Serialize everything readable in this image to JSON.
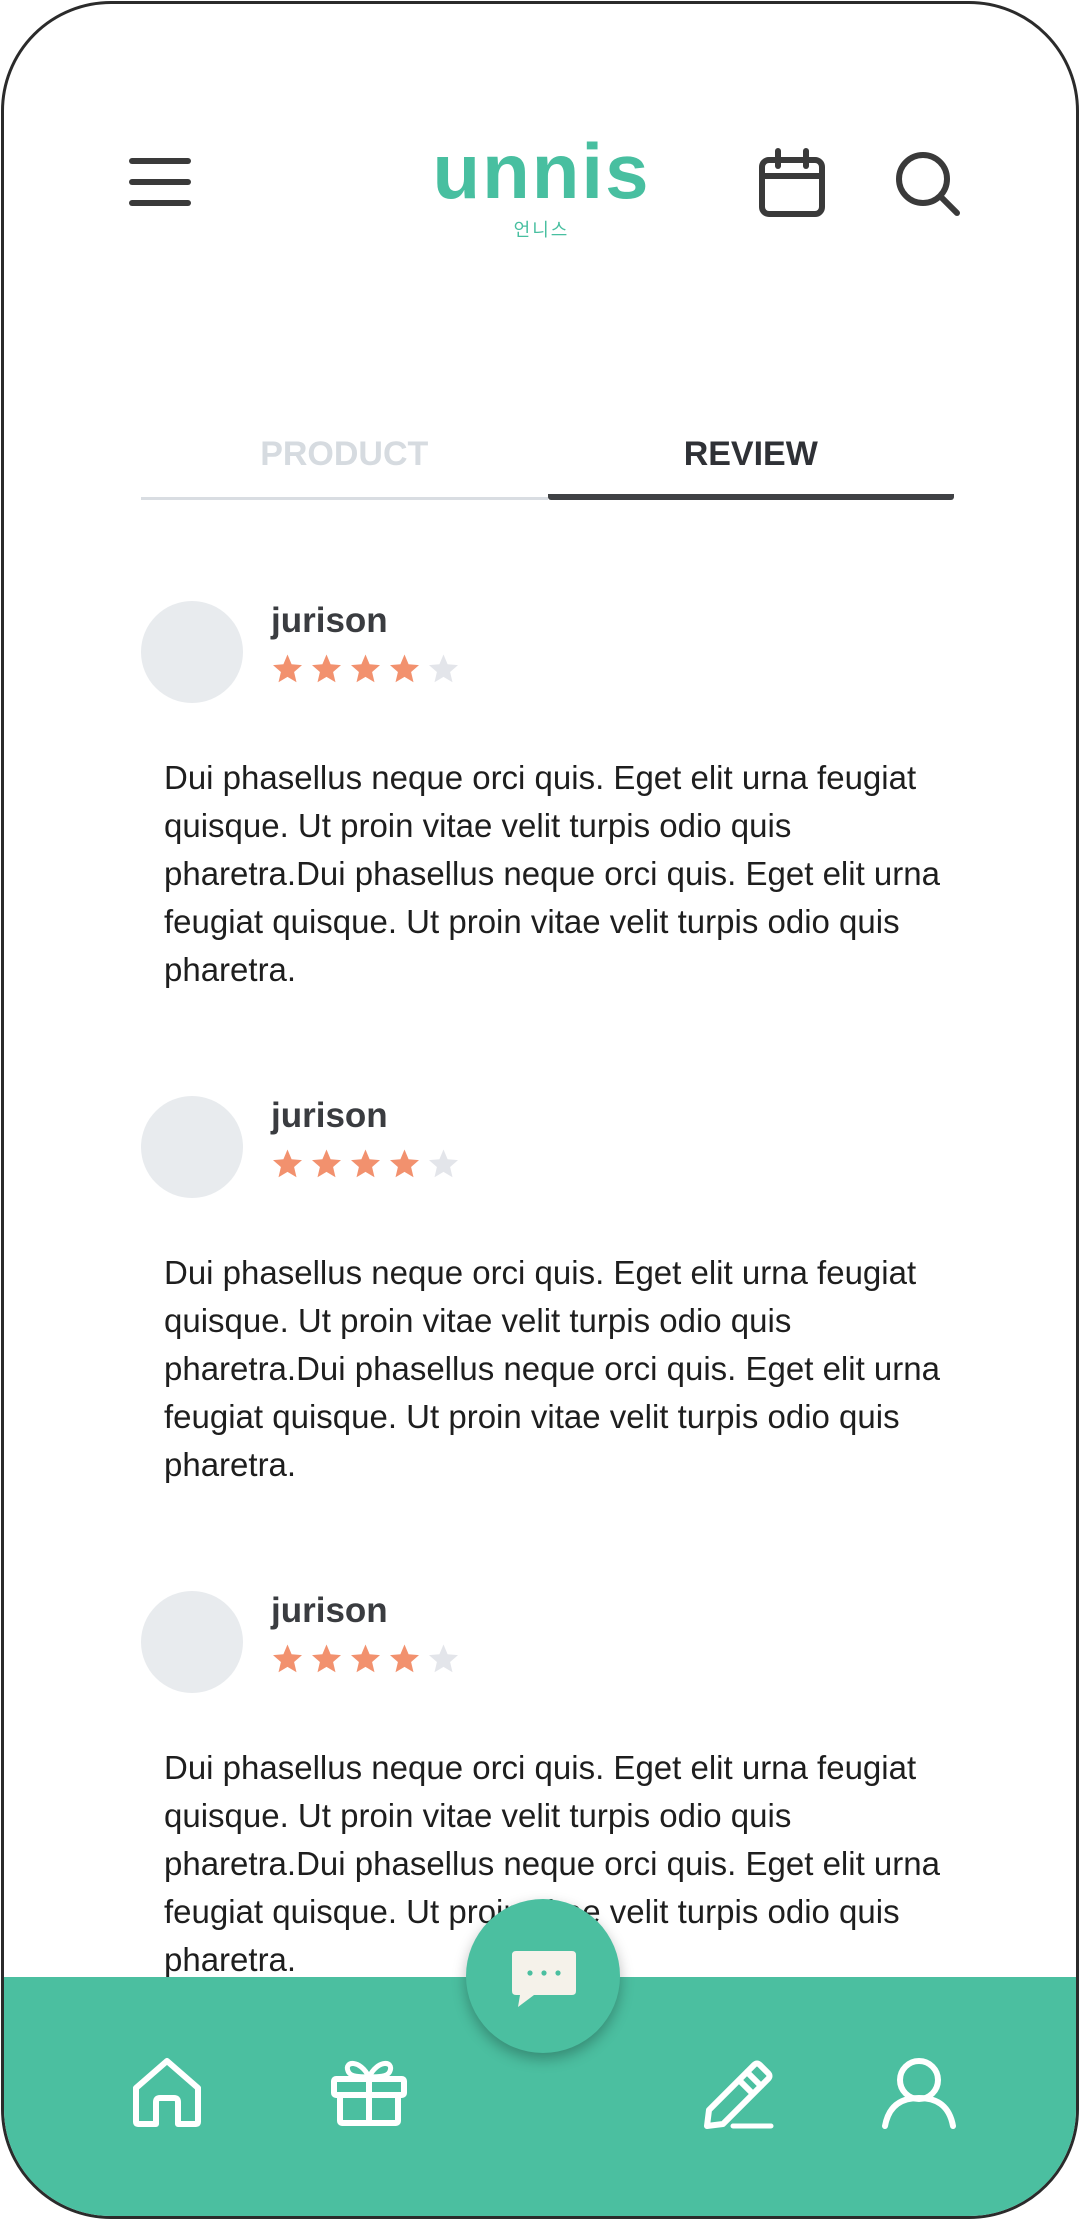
{
  "app": {
    "logo_text": "unnis",
    "logo_subtitle": "언니스"
  },
  "header": {
    "menu_icon": "hamburger-menu-icon",
    "calendar_icon": "calendar-icon",
    "search_icon": "search-icon"
  },
  "tabs": [
    {
      "label": "PRODUCT",
      "active": false
    },
    {
      "label": "REVIEW",
      "active": true
    }
  ],
  "reviews": [
    {
      "username": "jurison",
      "rating": 4,
      "max_rating": 5,
      "text": "Dui phasellus neque orci quis. Eget elit urna feugiat quisque. Ut proin vitae velit turpis odio quis pharetra.Dui phasellus neque orci quis. Eget elit urna feugiat quisque. Ut proin vitae velit turpis odio quis pharetra."
    },
    {
      "username": "jurison",
      "rating": 4,
      "max_rating": 5,
      "text": "Dui phasellus neque orci quis. Eget elit urna feugiat quisque. Ut proin vitae velit turpis odio quis pharetra.Dui phasellus neque orci quis. Eget elit urna feugiat quisque. Ut proin vitae velit turpis odio quis pharetra."
    },
    {
      "username": "jurison",
      "rating": 4,
      "max_rating": 5,
      "text": "Dui phasellus neque orci quis. Eget elit urna feugiat quisque. Ut proin vitae velit turpis odio quis pharetra.Dui phasellus neque orci quis. Eget elit urna feugiat quisque. Ut proin vitae velit turpis odio quis pharetra."
    }
  ],
  "bottom_nav": {
    "items": [
      "home-icon",
      "gift-icon",
      "chat-icon",
      "pencil-icon",
      "user-icon"
    ]
  },
  "colors": {
    "brand": "#4bbfa0",
    "star_filled": "#f2916e",
    "star_empty": "#e3e5ea",
    "tab_inactive": "#d6dbe0",
    "tab_active": "#2f3136"
  }
}
